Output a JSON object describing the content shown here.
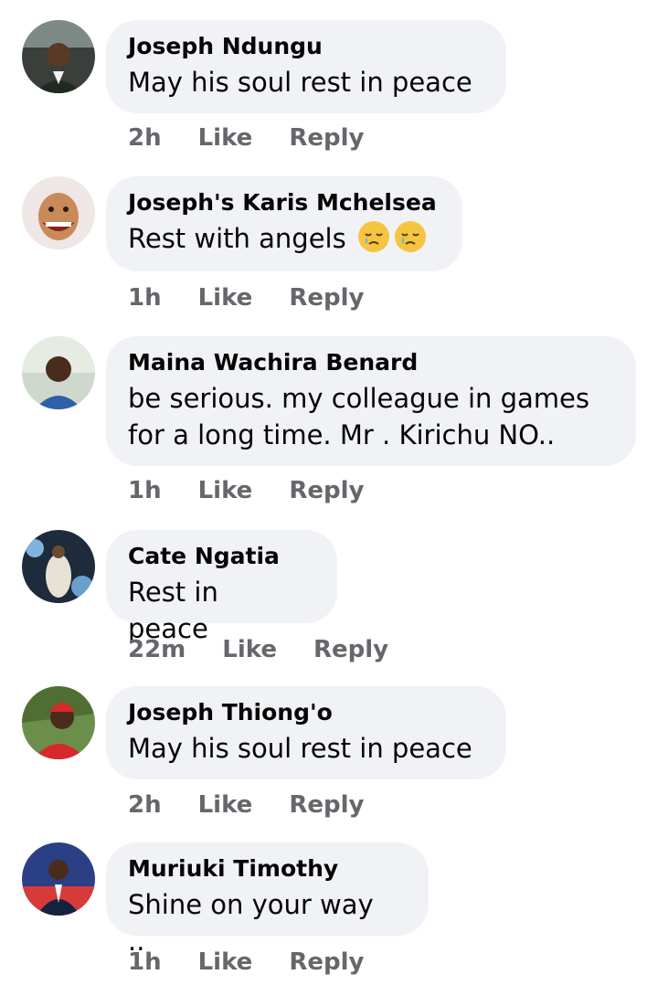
{
  "comments": [
    {
      "author": "Joseph Ndungu",
      "text": "May his soul rest in peace",
      "time": "2h",
      "like": "Like",
      "reply": "Reply"
    },
    {
      "author": "Joseph's Karis Mchelsea",
      "text": "Rest with angels",
      "time": "1h",
      "like": "Like",
      "reply": "Reply",
      "emoji": [
        "crying-face",
        "crying-face"
      ]
    },
    {
      "author": "Maina Wachira Benard",
      "text": "be serious. my colleague in games\nfor a long time. Mr . Kirichu NO..",
      "time": "1h",
      "like": "Like",
      "reply": "Reply"
    },
    {
      "author": "Cate Ngatia",
      "text": "Rest in peace",
      "time": "22m",
      "like": "Like",
      "reply": "Reply"
    },
    {
      "author": "Joseph Thiong'o",
      "text": "May his soul rest in peace",
      "time": "2h",
      "like": "Like",
      "reply": "Reply"
    },
    {
      "author": "Muriuki Timothy",
      "text": "Shine on your way ..",
      "time": "1h",
      "like": "Like",
      "reply": "Reply"
    }
  ],
  "colors": {
    "bubble": "#f0f2f5",
    "meta_text": "#65676b",
    "text": "#050505"
  }
}
